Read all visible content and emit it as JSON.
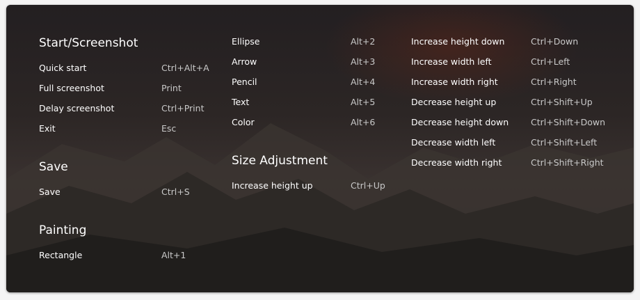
{
  "sections": {
    "start": {
      "title": "Start/Screenshot",
      "items": [
        {
          "label": "Quick start",
          "key": "Ctrl+Alt+A"
        },
        {
          "label": "Full screenshot",
          "key": "Print"
        },
        {
          "label": "Delay screenshot",
          "key": "Ctrl+Print"
        },
        {
          "label": "Exit",
          "key": "Esc"
        }
      ]
    },
    "save": {
      "title": "Save",
      "items": [
        {
          "label": "Save",
          "key": "Ctrl+S"
        }
      ]
    },
    "painting": {
      "title": "Painting",
      "items": [
        {
          "label": "Rectangle",
          "key": "Alt+1"
        },
        {
          "label": "Ellipse",
          "key": "Alt+2"
        },
        {
          "label": "Arrow",
          "key": "Alt+3"
        },
        {
          "label": "Pencil",
          "key": "Alt+4"
        },
        {
          "label": "Text",
          "key": "Alt+5"
        },
        {
          "label": "Color",
          "key": "Alt+6"
        }
      ]
    },
    "size": {
      "title": "Size Adjustment",
      "items": [
        {
          "label": "Increase height up",
          "key": "Ctrl+Up"
        },
        {
          "label": "Increase height down",
          "key": "Ctrl+Down"
        },
        {
          "label": "Increase width left",
          "key": "Ctrl+Left"
        },
        {
          "label": "Increase width right",
          "key": "Ctrl+Right"
        },
        {
          "label": "Decrease height up",
          "key": "Ctrl+Shift+Up"
        },
        {
          "label": "Decrease height down",
          "key": "Ctrl+Shift+Down"
        },
        {
          "label": "Decrease width left",
          "key": "Ctrl+Shift+Left"
        },
        {
          "label": "Decrease width right",
          "key": "Ctrl+Shift+Right"
        }
      ]
    }
  }
}
